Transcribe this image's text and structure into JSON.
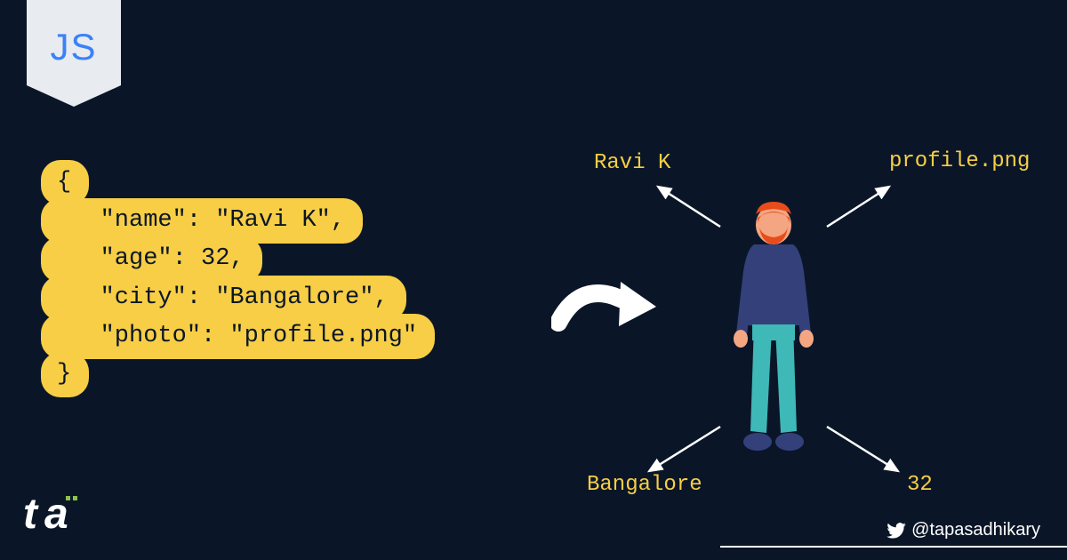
{
  "badge": {
    "label": "JS"
  },
  "code": {
    "open": "{",
    "line1": "   \"name\": \"Ravi K\",",
    "line2": "   \"age\": 32,",
    "line3": "   \"city\": \"Bangalore\",",
    "line4": "   \"photo\": \"profile.png\"",
    "close": "}"
  },
  "labels": {
    "name": "Ravi K",
    "photo": "profile.png",
    "city": "Bangalore",
    "age": "32"
  },
  "footer": {
    "handle": "@tapasadhikary"
  }
}
